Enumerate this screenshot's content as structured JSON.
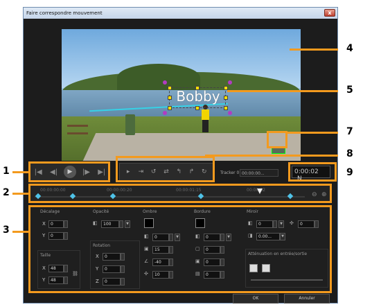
{
  "window": {
    "title": "Faire correspondre mouvement",
    "close_glyph": "x"
  },
  "preview": {
    "text_object": "Bobby"
  },
  "transport": {
    "buttons": [
      "|◀",
      "◀|",
      "▶",
      "|▶",
      "▶|"
    ]
  },
  "toolbar": {
    "tools": [
      "▸",
      "⇥",
      "↺",
      "⇄",
      "↰",
      "↱",
      "↻"
    ]
  },
  "tracker": {
    "label": "Tracker 01",
    "time": "00:00:00..."
  },
  "timecode": {
    "value": "0:00:02",
    "unit": "N"
  },
  "timeline": {
    "ticks": [
      "00:00:00:00",
      "00:00:00:20",
      "00:00:01:15",
      "00:00:02"
    ]
  },
  "props": {
    "offset": {
      "title": "Décalage",
      "x_label": "X",
      "x_value": "0",
      "y_label": "Y",
      "y_value": "0"
    },
    "size": {
      "title": "Taille",
      "x_label": "X",
      "x_value": "48",
      "y_label": "Y",
      "y_value": "48"
    },
    "opacity": {
      "title": "Opacité",
      "value": "100"
    },
    "rotation": {
      "title": "Rotation",
      "x_label": "X",
      "x_value": "0",
      "y_label": "Y",
      "y_value": "0",
      "z_label": "Z",
      "z_value": "0"
    },
    "shadow": {
      "title": "Ombre",
      "v1": "0",
      "v2": "15",
      "v3": "-40",
      "v4": "10"
    },
    "border": {
      "title": "Bordure",
      "v1": "0",
      "v2": "0",
      "v3": "0",
      "v4": "0"
    },
    "mirror": {
      "title": "Miroir",
      "v1": "0",
      "v2": "0",
      "v3": "0.00..."
    },
    "fade": {
      "title": "Atténuation en entrée/sortie"
    }
  },
  "buttons": {
    "ok": "OK",
    "cancel": "Annuler"
  },
  "callouts": [
    "1",
    "2",
    "3",
    "4",
    "5",
    "7",
    "8",
    "9"
  ],
  "colors": {
    "callout": "#f39a1e",
    "keyframe": "#4fc3e8",
    "handle": "#ffe000"
  }
}
